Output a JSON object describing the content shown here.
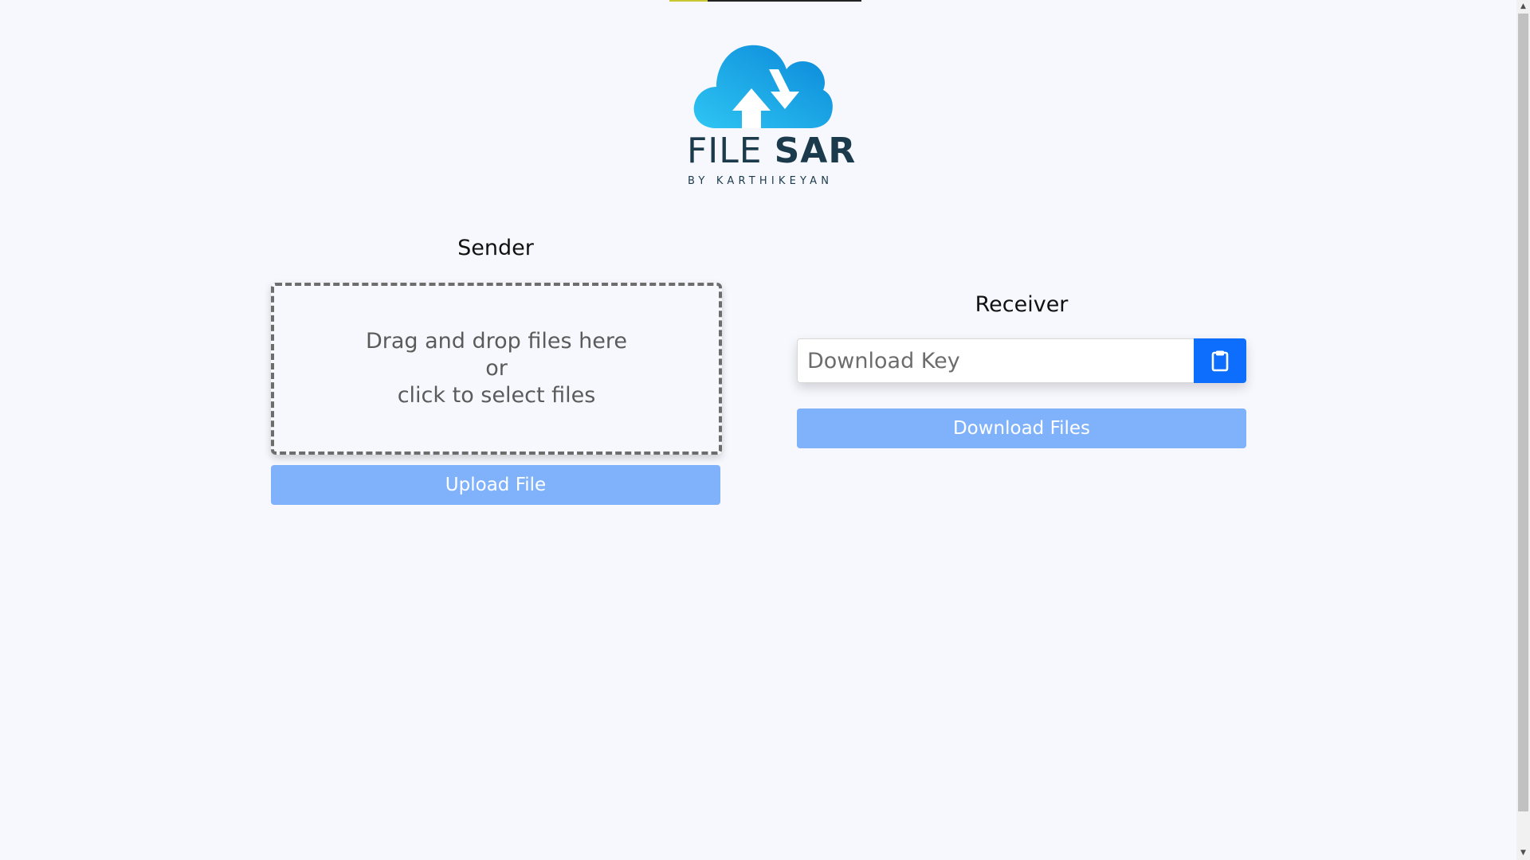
{
  "colors": {
    "page_background": "#f7f8fd",
    "cloud_gradient_start": "#2ec6f3",
    "cloud_gradient_end": "#0a86d8",
    "brand_text": "#1b3a4b",
    "primary": "#0d6efd",
    "primary_disabled": "#80b2fc",
    "top_stripe_a": "#c9c832",
    "top_stripe_b": "#222222"
  },
  "logo": {
    "brand_thin": "FILE ",
    "brand_bold": "SAR",
    "tagline": "BY KARTHIKEYAN",
    "icon": "cloud-transfer-icon"
  },
  "sender": {
    "title": "Sender",
    "dropzone": {
      "line1": "Drag and drop files here",
      "line2": "or",
      "line3": "click to select files"
    },
    "upload_label": "Upload File"
  },
  "receiver": {
    "title": "Receiver",
    "key_placeholder": "Download Key",
    "key_value": "",
    "paste_icon": "clipboard-icon",
    "download_label": "Download Files"
  },
  "scrollbar": {
    "up_icon": "arrow-up-icon",
    "down_icon": "arrow-down-icon"
  }
}
